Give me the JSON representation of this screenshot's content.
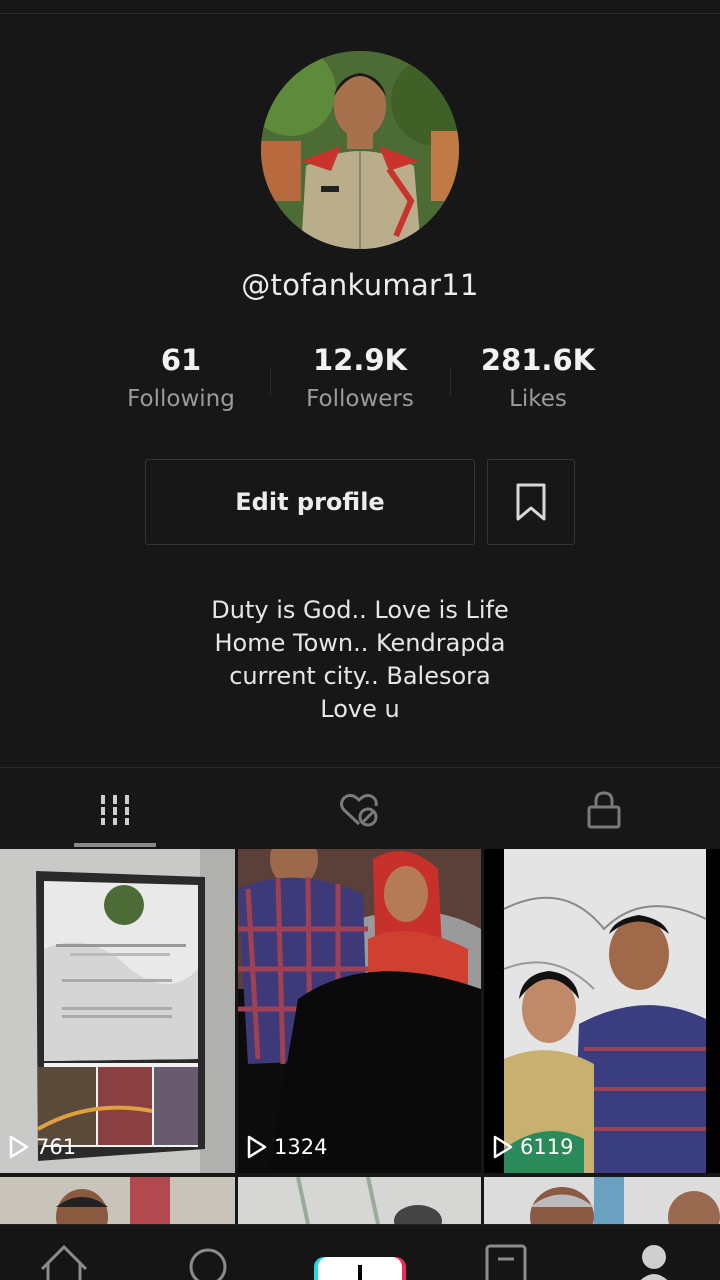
{
  "profile": {
    "username": "@tofankumar11",
    "stats": [
      {
        "value": "61",
        "label": "Following"
      },
      {
        "value": "12.9K",
        "label": "Followers"
      },
      {
        "value": "281.6K",
        "label": "Likes"
      }
    ],
    "edit_profile_label": "Edit profile",
    "bio_lines": [
      "Duty is God.. Love is Life",
      "Home Town.. Kendrapda",
      "current city.. Balesora",
      "Love u"
    ]
  },
  "tabs": [
    {
      "name": "videos-grid-icon",
      "active": true
    },
    {
      "name": "liked-videos-icon",
      "active": false
    },
    {
      "name": "private-videos-icon",
      "active": false
    }
  ],
  "videos": [
    {
      "views": "761"
    },
    {
      "views": "1324"
    },
    {
      "views": "6119"
    }
  ],
  "colors": {
    "background": "#171717",
    "secondary_text": "#9b9b9b",
    "border": "#353535"
  }
}
